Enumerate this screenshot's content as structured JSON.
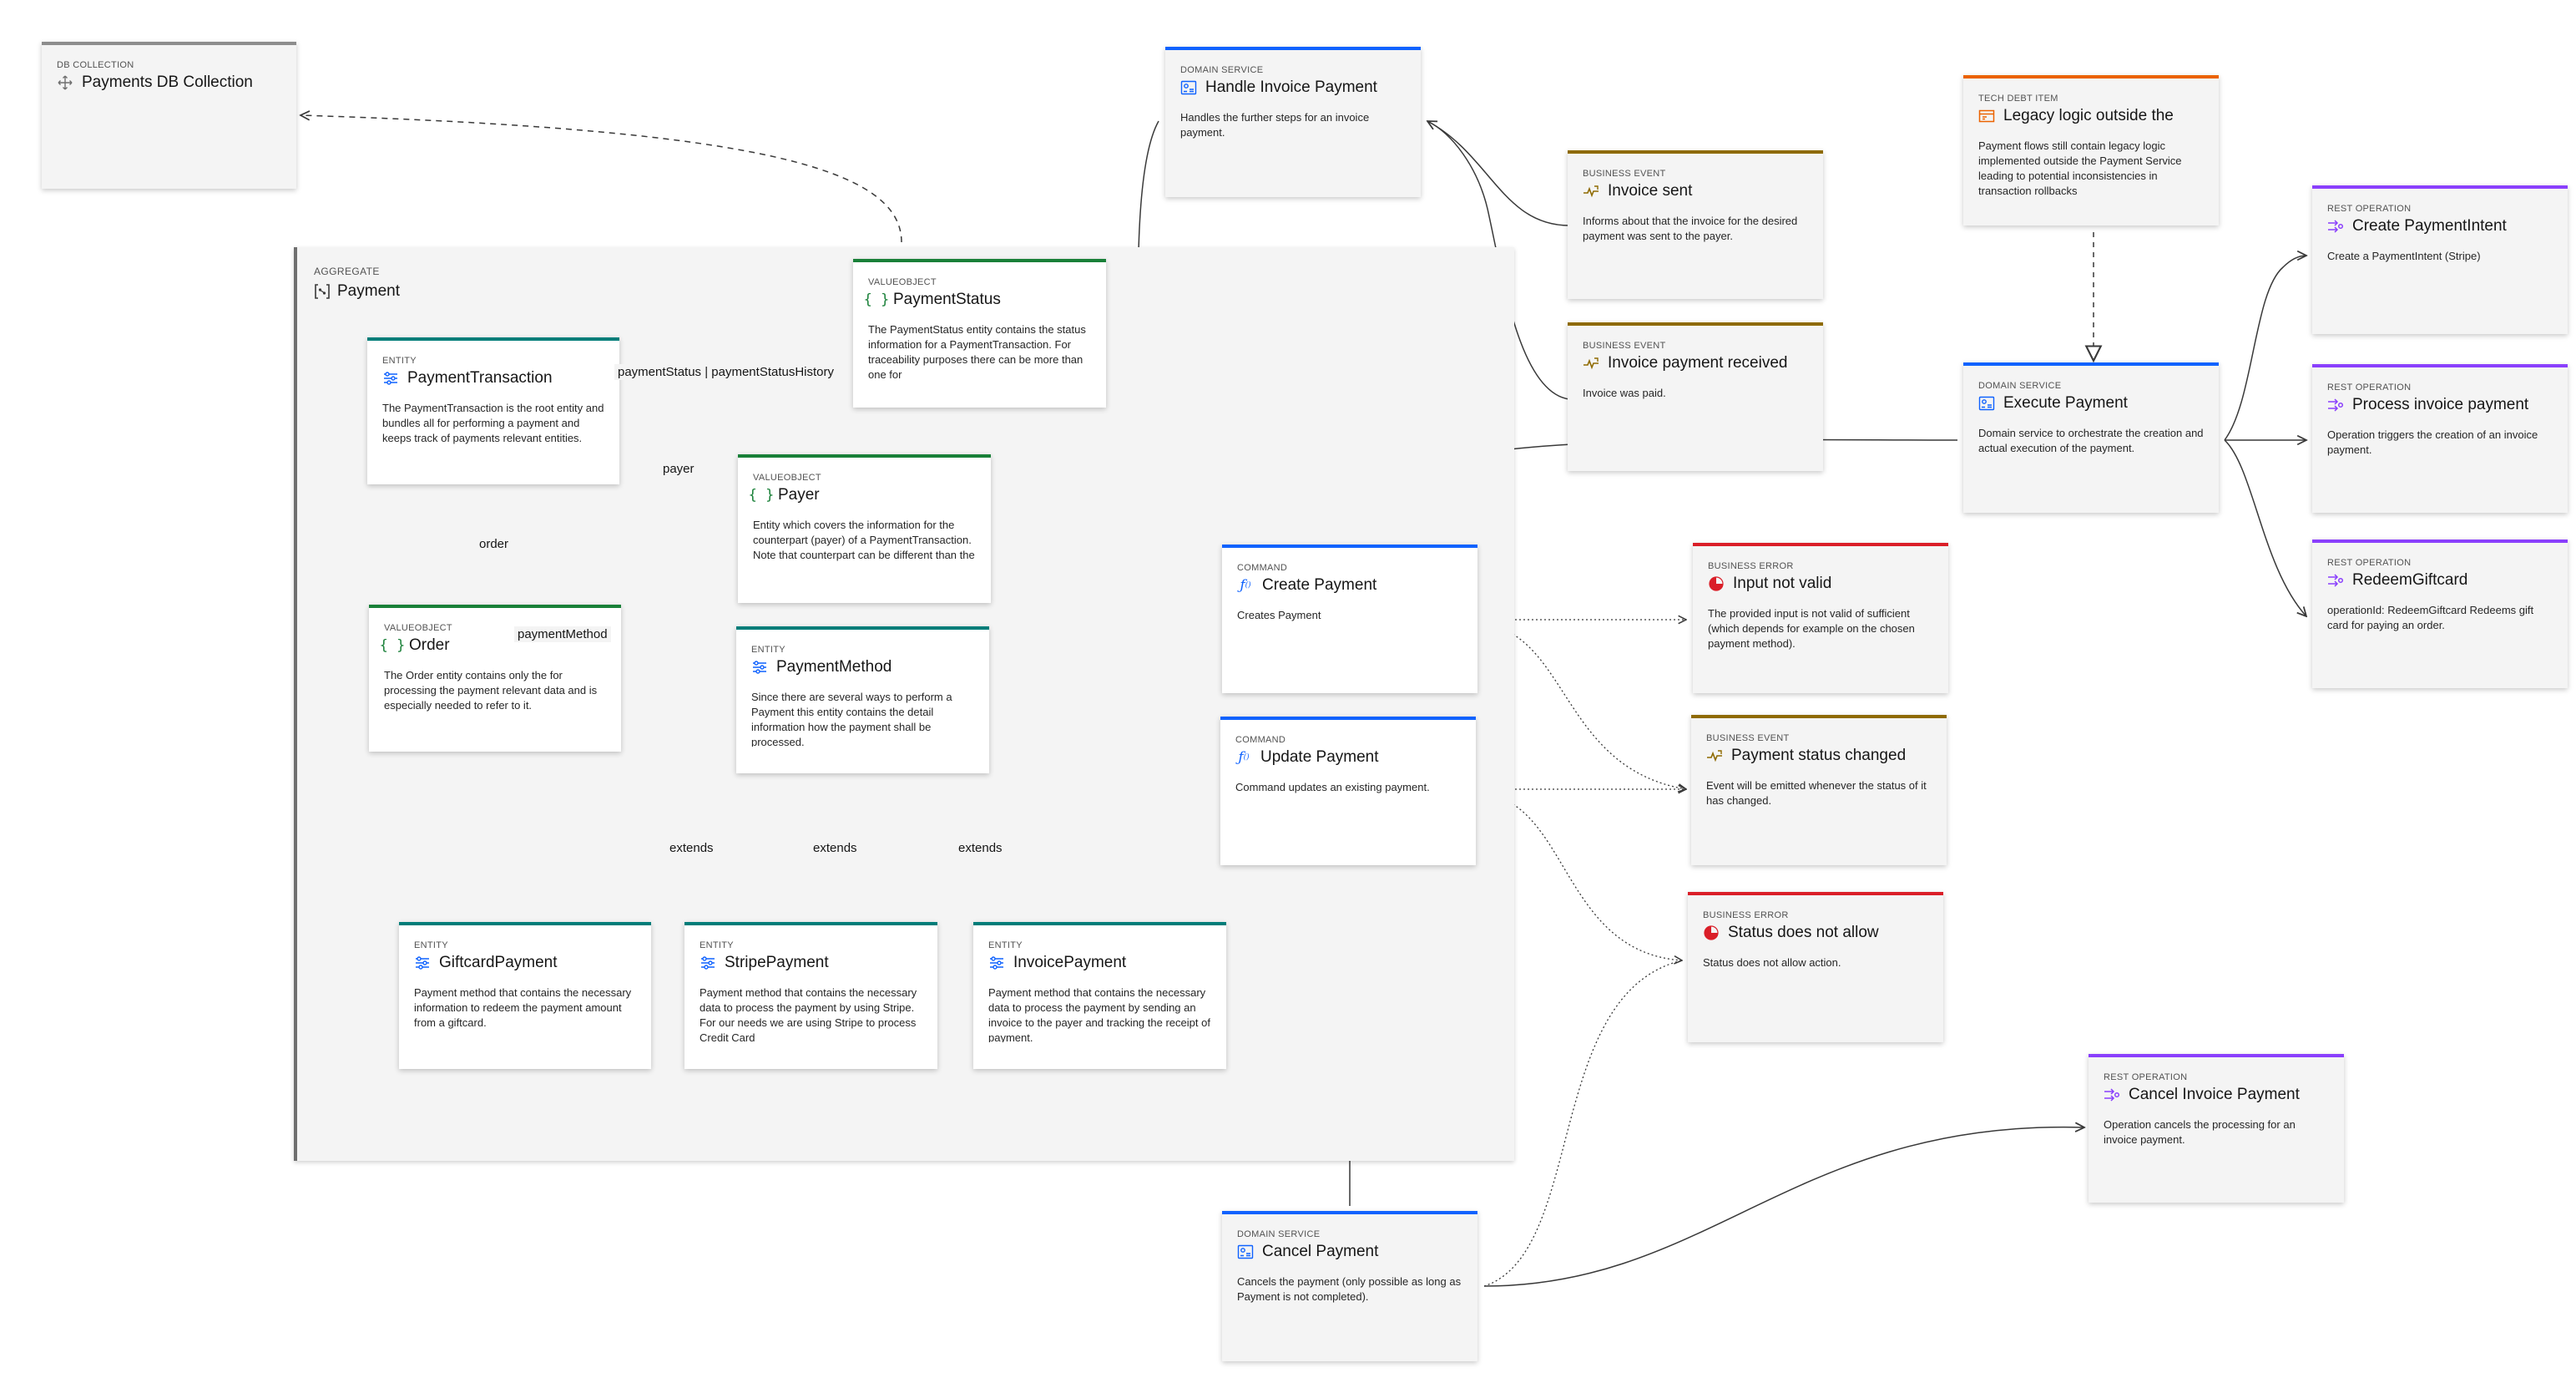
{
  "aggregate": {
    "type": "AGGREGATE",
    "title": "Payment"
  },
  "cards": {
    "db_collection": {
      "type": "DB COLLECTION",
      "title": "Payments DB Collection",
      "desc": ""
    },
    "payment_transaction": {
      "type": "ENTITY",
      "title": "PaymentTransaction",
      "desc": "The PaymentTransaction is the root entity and bundles all for performing a payment and keeps track of payments relevant entities."
    },
    "payment_status": {
      "type": "VALUEOBJECT",
      "title": "PaymentStatus",
      "desc": "The PaymentStatus entity contains the status information for a PaymentTransaction. For traceability purposes there can be more than one for"
    },
    "payer": {
      "type": "VALUEOBJECT",
      "title": "Payer",
      "desc": "Entity which covers the information for the counterpart (payer) of a PaymentTransaction. Note that counterpart can be different than the"
    },
    "order": {
      "type": "VALUEOBJECT",
      "title": "Order",
      "desc": "The Order entity contains only the for processing the payment relevant data and is especially needed to refer to it."
    },
    "payment_method": {
      "type": "ENTITY",
      "title": "PaymentMethod",
      "desc": "Since there are several ways to perform a Payment this entity contains the detail information how the payment shall be processed."
    },
    "giftcard_payment": {
      "type": "ENTITY",
      "title": "GiftcardPayment",
      "desc": "Payment method that contains the necessary information to redeem the payment amount from a giftcard."
    },
    "stripe_payment": {
      "type": "ENTITY",
      "title": "StripePayment",
      "desc": "Payment method that contains the necessary data to process the payment by using Stripe. For our needs we are using Stripe to process Credit Card"
    },
    "invoice_payment": {
      "type": "ENTITY",
      "title": "InvoicePayment",
      "desc": "Payment method that contains the necessary data to process the payment by sending an invoice to the payer and tracking the receipt of payment."
    },
    "handle_invoice_payment": {
      "type": "DOMAIN SERVICE",
      "title": "Handle Invoice Payment",
      "desc": "Handles the further steps for an invoice payment."
    },
    "invoice_sent": {
      "type": "BUSINESS EVENT",
      "title": "Invoice sent",
      "desc": "Informs about that the invoice for the desired payment was sent to the payer."
    },
    "invoice_payment_received": {
      "type": "BUSINESS EVENT",
      "title": "Invoice payment received",
      "desc": "Invoice was paid."
    },
    "legacy_logic": {
      "type": "TECH DEBT ITEM",
      "title": "Legacy logic outside the",
      "desc": "Payment flows still contain legacy logic implemented outside the Payment Service leading to potential inconsistencies in transaction rollbacks"
    },
    "execute_payment": {
      "type": "DOMAIN SERVICE",
      "title": "Execute Payment",
      "desc": "Domain service to orchestrate the creation and actual execution of the payment."
    },
    "create_payment_intent": {
      "type": "REST OPERATION",
      "title": "Create PaymentIntent",
      "desc": "Create a PaymentIntent (Stripe)"
    },
    "process_invoice_payment": {
      "type": "REST OPERATION",
      "title": "Process invoice payment",
      "desc": "Operation triggers the creation of an invoice payment."
    },
    "redeem_giftcard": {
      "type": "REST OPERATION",
      "title": "RedeemGiftcard",
      "desc": "operationId: RedeemGiftcard Redeems gift card for paying an order."
    },
    "create_payment": {
      "type": "COMMAND",
      "title": "Create Payment",
      "desc": "Creates Payment"
    },
    "update_payment": {
      "type": "COMMAND",
      "title": "Update Payment",
      "desc": "Command updates an existing payment."
    },
    "input_not_valid": {
      "type": "BUSINESS ERROR",
      "title": "Input not valid",
      "desc": "The provided input is not valid of sufficient (which depends for example on the chosen payment method)."
    },
    "payment_status_changed": {
      "type": "BUSINESS EVENT",
      "title": "Payment status changed",
      "desc": "Event will be emitted whenever the status of it has changed."
    },
    "status_does_not_allow": {
      "type": "BUSINESS ERROR",
      "title": "Status does not allow",
      "desc": "Status does not allow action."
    },
    "cancel_payment": {
      "type": "DOMAIN SERVICE",
      "title": "Cancel Payment",
      "desc": "Cancels the payment (only possible as long as Payment is not completed)."
    },
    "cancel_invoice_payment": {
      "type": "REST OPERATION",
      "title": "Cancel Invoice Payment",
      "desc": "Operation cancels the processing for an invoice payment."
    }
  },
  "edge_labels": {
    "payment_status": "paymentStatus | paymentStatusHistory",
    "payer": "payer",
    "order": "order",
    "payment_method": "paymentMethod",
    "extends_giftcard": "extends",
    "extends_stripe": "extends",
    "extends_invoice": "extends"
  },
  "colors": {
    "domain_service": "#0f62fe",
    "entity": "#007d79",
    "valueobject": "#198038",
    "business_event": "#8e6a00",
    "business_error": "#da1e28",
    "rest_operation": "#8a3ffc",
    "tech_debt": "#eb6200",
    "db_collection": "#8d8d8d"
  },
  "icons": {
    "db_collection": "move-arrows-icon",
    "aggregate": "aggregate-bracket-icon",
    "entity": "sliders-icon",
    "valueobject": "curly-braces-icon",
    "domain_service": "service-gear-icon",
    "business_event": "event-pulse-icon",
    "business_error": "error-pie-icon",
    "rest_operation": "rest-arrows-icon",
    "command": "function-icon",
    "tech_debt": "debt-box-icon"
  }
}
